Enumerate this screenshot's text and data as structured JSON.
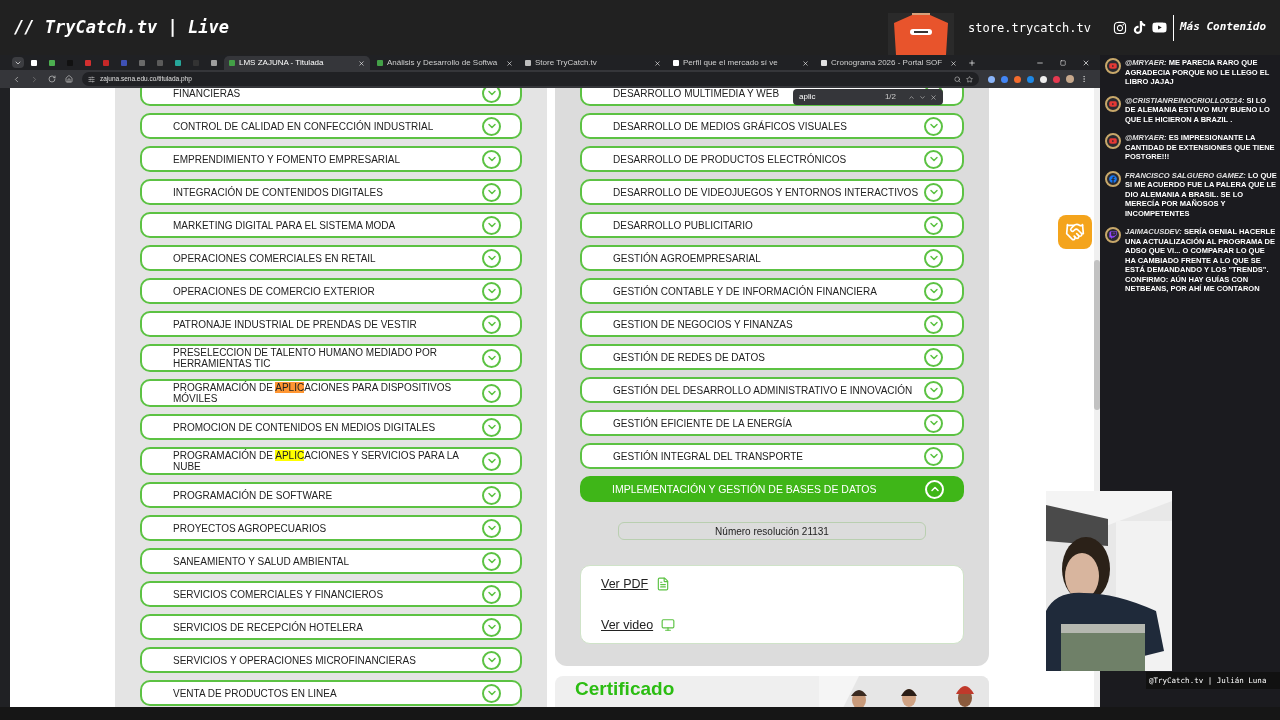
{
  "overlay": {
    "title": "// TryCatch.tv | Live",
    "store": "store.trycatch.tv",
    "more": "Más Contenido",
    "caption": "@TryCatch.tv | Julián Luna"
  },
  "browser": {
    "tabs": [
      {
        "kind": "icon",
        "color": "#ffffff",
        "selected": false
      },
      {
        "kind": "icon",
        "color": "#4caf50",
        "selected": false
      },
      {
        "kind": "icon",
        "color": "#111111",
        "selected": false
      },
      {
        "kind": "icon",
        "color": "#d32f2f",
        "selected": false
      },
      {
        "kind": "icon",
        "color": "#c62828",
        "selected": false
      },
      {
        "kind": "icon",
        "color": "#3f51b5",
        "selected": false
      },
      {
        "kind": "icon",
        "color": "#6a6a6a",
        "selected": false
      },
      {
        "kind": "icon",
        "color": "#5a5a5a",
        "selected": false
      },
      {
        "kind": "icon",
        "color": "#26a69a",
        "selected": false
      },
      {
        "kind": "icon",
        "color": "#333333",
        "selected": false
      },
      {
        "kind": "icon",
        "color": "#9e9e9e",
        "selected": false
      },
      {
        "kind": "titled",
        "color": "#43a047",
        "title": "LMS ZAJUNA - Titulada",
        "selected": true
      },
      {
        "kind": "titled",
        "color": "#43a047",
        "title": "Análisis y Desarrollo de Softwa",
        "selected": false
      },
      {
        "kind": "titled",
        "color": "#bdbdbd",
        "title": "Store TryCatch.tv",
        "selected": false
      },
      {
        "kind": "titled",
        "color": "#ffffff",
        "title": "Perfil que el mercado sí ve",
        "selected": false
      },
      {
        "kind": "titled",
        "color": "#e0e0e0",
        "title": "Cronograma 2026 - Portal SOF",
        "selected": false
      }
    ],
    "url": "zajuna.sena.edu.co/titulada.php",
    "find": {
      "value": "aplic",
      "count": "1/2"
    }
  },
  "left_programs": [
    {
      "label": "FINANCIERAS",
      "expanded": false
    },
    {
      "label": "CONTROL DE CALIDAD EN CONFECCIÓN INDUSTRIAL",
      "expanded": false
    },
    {
      "label": "EMPRENDIMIENTO Y FOMENTO EMPRESARIAL",
      "expanded": false
    },
    {
      "label": "INTEGRACIÓN DE CONTENIDOS DIGITALES",
      "expanded": false
    },
    {
      "label": "MARKETING DIGITAL PARA EL SISTEMA MODA",
      "expanded": false
    },
    {
      "label": "OPERACIONES COMERCIALES EN RETAIL",
      "expanded": false
    },
    {
      "label": "OPERACIONES DE COMERCIO EXTERIOR",
      "expanded": false
    },
    {
      "label": "PATRONAJE INDUSTRIAL DE PRENDAS DE VESTIR",
      "expanded": false
    },
    {
      "label": "PRESELECCION DE TALENTO HUMANO MEDIADO POR HERRAMIENTAS TIC",
      "expanded": false
    },
    {
      "label": "PROGRAMACIÓN DE ",
      "match": "APLIC",
      "after": "ACIONES PARA DISPOSITIVOS MÓVILES",
      "match_current": true,
      "expanded": false
    },
    {
      "label": "PROMOCION DE CONTENIDOS EN MEDIOS DIGITALES",
      "expanded": false
    },
    {
      "label": "PROGRAMACIÓN DE ",
      "match": "APLIC",
      "after": "ACIONES Y SERVICIOS PARA LA NUBE",
      "match_current": false,
      "expanded": false
    },
    {
      "label": "PROGRAMACIÓN DE SOFTWARE",
      "expanded": false
    },
    {
      "label": "PROYECTOS AGROPECUARIOS",
      "expanded": false
    },
    {
      "label": "SANEAMIENTO Y SALUD AMBIENTAL",
      "expanded": false
    },
    {
      "label": "SERVICIOS COMERCIALES Y FINANCIEROS",
      "expanded": false
    },
    {
      "label": "SERVICIOS DE RECEPCIÓN HOTELERA",
      "expanded": false
    },
    {
      "label": "SERVICIOS Y OPERACIONES MICROFINANCIERAS",
      "expanded": false
    },
    {
      "label": "VENTA DE PRODUCTOS EN LINEA",
      "expanded": false
    }
  ],
  "right_programs": [
    {
      "label": "DESARROLLO MULTIMEDIA Y WEB",
      "expanded": false
    },
    {
      "label": "DESARROLLO DE MEDIOS GRÁFICOS VISUALES",
      "expanded": false
    },
    {
      "label": "DESARROLLO DE PRODUCTOS ELECTRÓNICOS",
      "expanded": false
    },
    {
      "label": "DESARROLLO DE VIDEOJUEGOS Y ENTORNOS INTERACTIVOS",
      "expanded": false
    },
    {
      "label": "DESARROLLO PUBLICITARIO",
      "expanded": false
    },
    {
      "label": "GESTIÓN AGROEMPRESARIAL",
      "expanded": false
    },
    {
      "label": "GESTIÓN CONTABLE Y DE INFORMACIÓN FINANCIERA",
      "expanded": false
    },
    {
      "label": "GESTION DE NEGOCIOS Y FINANZAS",
      "expanded": false
    },
    {
      "label": "GESTIÓN DE REDES DE DATOS",
      "expanded": false
    },
    {
      "label": "GESTIÓN DEL DESARROLLO ADMINISTRATIVO E INNOVACIÓN",
      "expanded": false
    },
    {
      "label": "GESTIÓN EFICIENTE DE LA ENERGÍA",
      "expanded": false
    },
    {
      "label": "GESTIÓN INTEGRAL DEL TRANSPORTE",
      "expanded": false
    },
    {
      "label": "IMPLEMENTACIÓN Y GESTIÓN DE BASES DE DATOS",
      "expanded": true
    }
  ],
  "details": {
    "resolution": "Número resolución 21131",
    "links": [
      {
        "kind": "pdf",
        "label": "Ver PDF"
      },
      {
        "kind": "video",
        "label": "Ver video"
      }
    ]
  },
  "banner": {
    "title": "Certificado"
  },
  "chat": [
    {
      "kind": "youtube",
      "user": "@MRYAER:",
      "text": " ME PARECIA RARO QUE AGRADECIA PORQUE NO LE LLEGO EL LIBRO JAJAJ"
    },
    {
      "kind": "youtube",
      "user": "@CRISTIANREINOCRIOLLO5214:",
      "text": " SI LO DE ALEMANIA ESTUVO MUY BUENO LO QUE LE HICIERON A BRAZIL ."
    },
    {
      "kind": "youtube",
      "user": "@MRYAER:",
      "text": " ES IMPRESIONANTE LA CANTIDAD DE EXTENSIONES QUE TIENE POSTGRE!!!"
    },
    {
      "kind": "facebook",
      "user": "FRANCISCO SALGUERO GAMEZ:",
      "text": " LO QUE SI ME ACUERDO FUE LA PALERA QUE LE DIO ALEMANIA A BRASIL. SE LO MERECÍA POR MAÑOSOS Y INCOMPETENTES"
    },
    {
      "kind": "twitch",
      "user": "JAIMACUSDEV:",
      "text": " SERÍA GENIAL HACERLE UNA ACTUALIZACIÓN AL PROGRAMA DE ADSO QUE VI... O COMPARAR LO QUE HA CAMBIADO FRENTE A LO QUE SE ESTÁ DEMANDANDO Y LOS \"TRENDS\". CONFIRMO: AÚN HAY GUÍAS CON NETBEANS, POR AHÍ ME CONTARON"
    }
  ]
}
